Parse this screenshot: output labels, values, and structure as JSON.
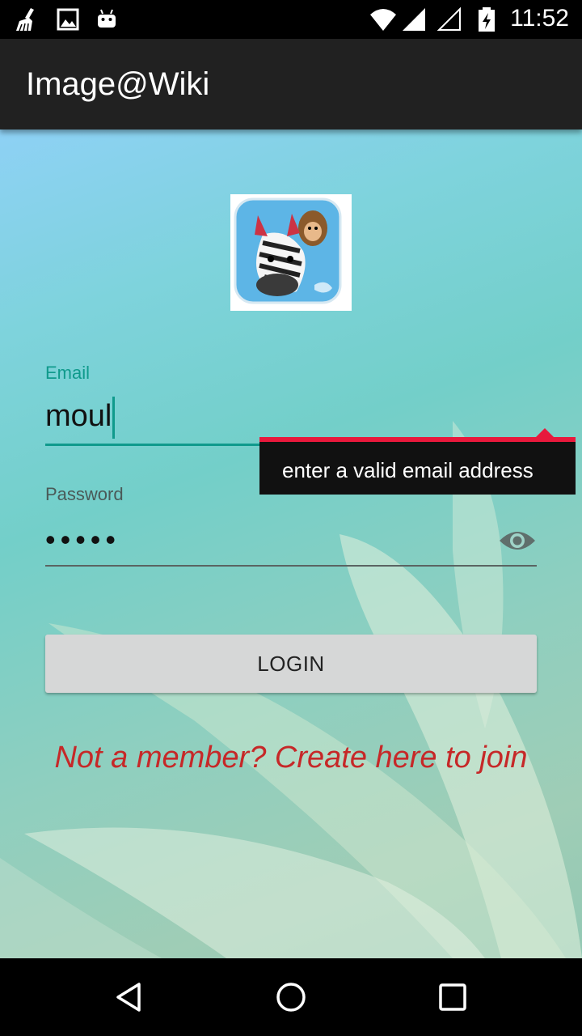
{
  "status_bar": {
    "time": "11:52",
    "left_icons": [
      "broom-icon",
      "image-icon",
      "android-icon"
    ],
    "right_icons": [
      "wifi-icon",
      "signal-icon",
      "signal-empty-icon",
      "battery-charging-icon"
    ]
  },
  "app_bar": {
    "title": "Image@Wiki"
  },
  "logo": {
    "icon": "zebra-monkey-app-logo"
  },
  "email": {
    "label": "Email",
    "value": "moul"
  },
  "error_popup": {
    "message": "enter a valid email address"
  },
  "password": {
    "label": "Password",
    "value": "•••••",
    "toggle_icon": "eye-icon"
  },
  "login_button": {
    "label": "LOGIN"
  },
  "signup_link": {
    "text": "Not a member? Create here to join"
  },
  "nav_bar": {
    "icons": [
      "back-icon",
      "home-icon",
      "recents-icon"
    ]
  },
  "colors": {
    "accent": "#0f9a8c",
    "error": "#e8193c",
    "link": "#c62828",
    "app_bar": "#212121"
  }
}
